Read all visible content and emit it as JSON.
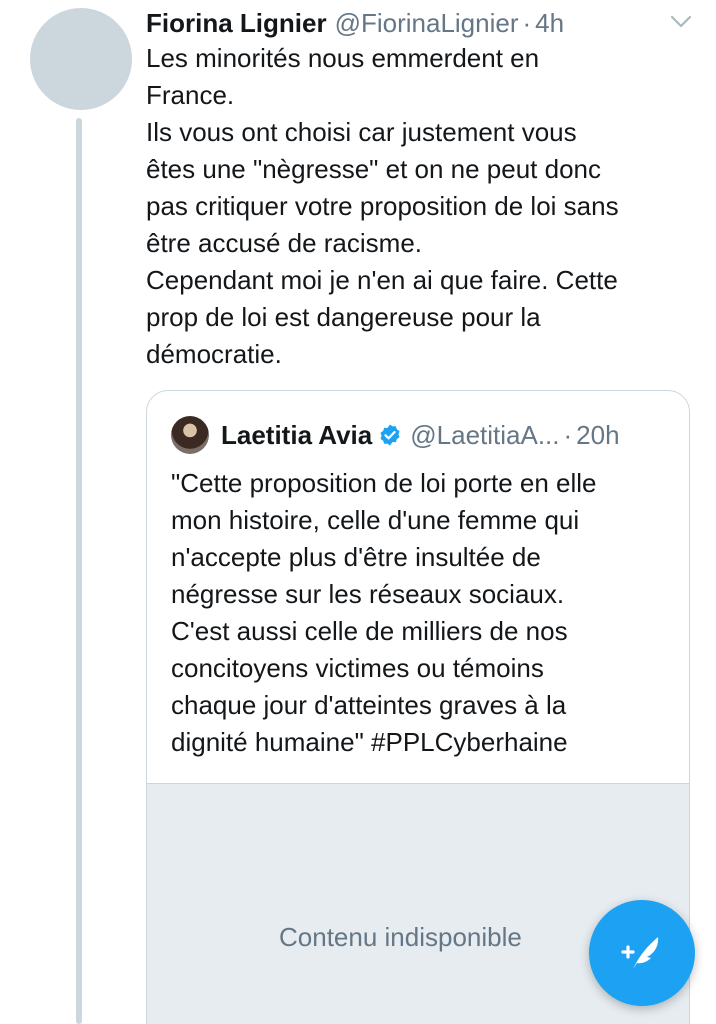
{
  "tweet": {
    "author_name": "Fiorina Lignier",
    "author_handle": "@FiorinaLignier",
    "separator": "·",
    "time": "4h",
    "body_lines": [
      "Les minorités nous emmerdent en",
      "France.",
      "Ils vous ont choisi car justement vous",
      "êtes une \"nègresse\" et on ne peut donc",
      "pas critiquer votre proposition de loi sans",
      "être accusé de racisme.",
      "Cependant moi je n'en ai que faire. Cette",
      "prop de loi est dangereuse pour la",
      "démocratie."
    ],
    "menu_icon": "chevron-down-icon"
  },
  "quoted_tweet": {
    "author_name": "Laetitia Avia",
    "verified": true,
    "author_handle": "@LaetitiaA...",
    "separator": "·",
    "time": "20h",
    "body_lines": [
      "\"Cette proposition de loi porte en elle",
      "mon histoire, celle d'une femme qui",
      "n'accepte plus d'être insultée de",
      "négresse sur les réseaux sociaux.",
      "C'est aussi celle de milliers de nos",
      "concitoyens victimes ou témoins",
      "chaque jour d'atteintes graves à la",
      "dignité humaine\" #PPLCyberhaine"
    ],
    "media_unavailable_label": "Contenu indisponible"
  },
  "compose_button": {
    "icon": "compose-tweet-icon"
  },
  "colors": {
    "accent": "#1da1f2",
    "text_primary": "#14171a",
    "text_secondary": "#657786",
    "border": "#ccd6dd",
    "media_placeholder": "#e6ecf0"
  }
}
